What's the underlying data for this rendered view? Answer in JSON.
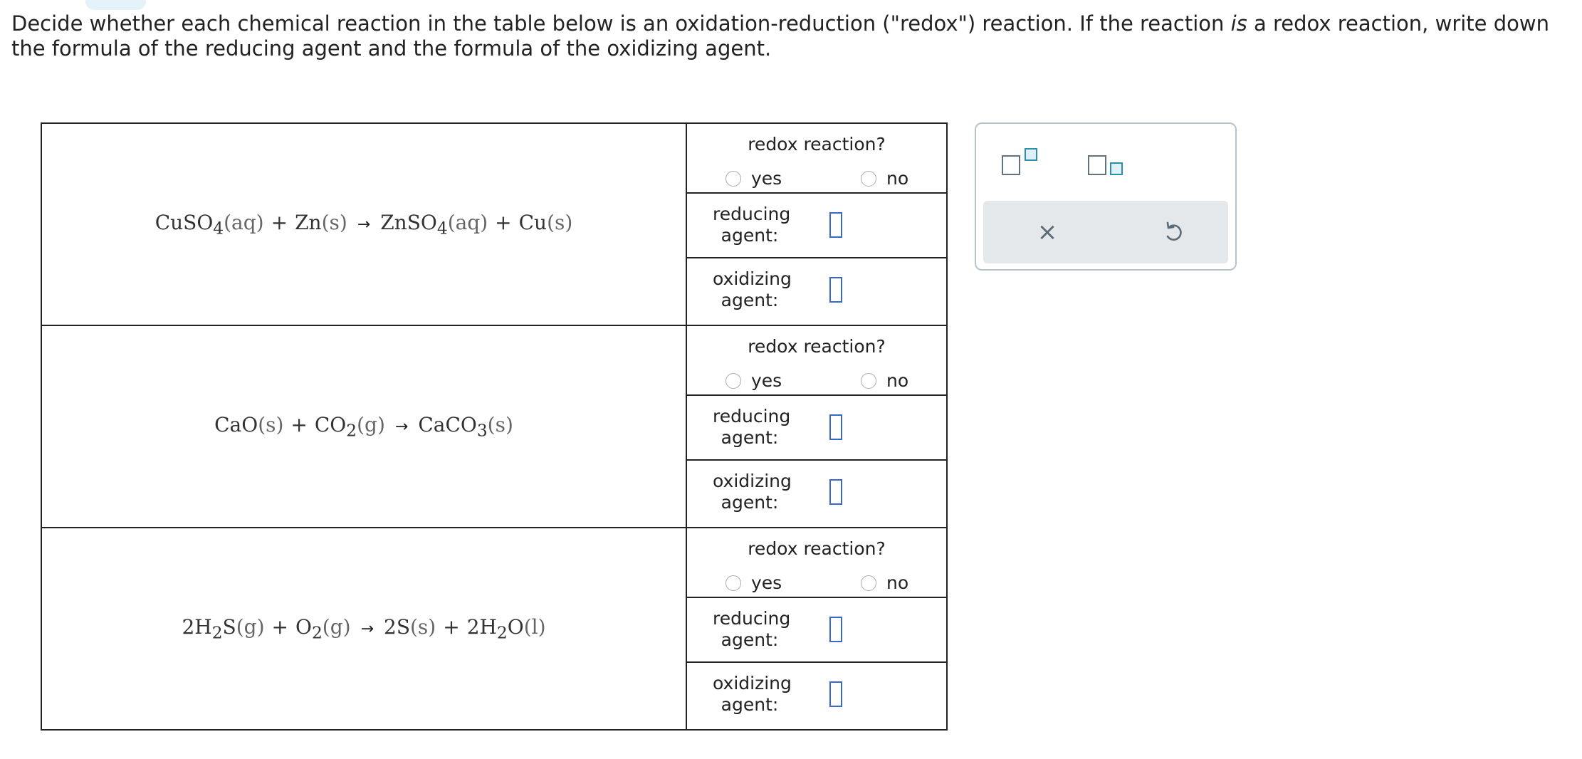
{
  "prompt": {
    "part1": "Decide whether each chemical reaction in the table below is an oxidation-reduction (\"redox\") reaction. If the reaction ",
    "em": "is",
    "part2": " a redox reaction, write down the formula of the reducing agent and the formula of the oxidizing agent."
  },
  "reactions": [
    {
      "question": "redox reaction?",
      "yes_label": "yes",
      "no_label": "no",
      "reducing_label": "reducing agent:",
      "oxidizing_label": "oxidizing agent:",
      "equation": {
        "r1": "CuSO",
        "r1_sub": "4",
        "r1_phase": "(aq)",
        "plus1": "+",
        "r2": "Zn",
        "r2_phase": "(s)",
        "arrow": "→",
        "p1": "ZnSO",
        "p1_sub": "4",
        "p1_phase": "(aq)",
        "plus2": "+",
        "p2": "Cu",
        "p2_phase": "(s)"
      }
    },
    {
      "question": "redox reaction?",
      "yes_label": "yes",
      "no_label": "no",
      "reducing_label": "reducing agent:",
      "oxidizing_label": "oxidizing agent:",
      "equation": {
        "r1": "CaO",
        "r1_phase": "(s)",
        "plus1": "+",
        "r2": "CO",
        "r2_sub": "2",
        "r2_phase": "(g)",
        "arrow": "→",
        "p1": "CaCO",
        "p1_sub": "3",
        "p1_phase": "(s)"
      }
    },
    {
      "question": "redox reaction?",
      "yes_label": "yes",
      "no_label": "no",
      "reducing_label": "reducing agent:",
      "oxidizing_label": "oxidizing agent:",
      "equation": {
        "r1": "2H",
        "r1_sub": "2",
        "r1_tail": "S",
        "r1_phase": "(g)",
        "plus1": "+",
        "r2": "O",
        "r2_sub": "2",
        "r2_phase": "(g)",
        "arrow": "→",
        "p1": "2S",
        "p1_phase": "(s)",
        "plus2": "+",
        "p2": "2H",
        "p2_sub": "2",
        "p2_tail": "O",
        "p2_phase": "(l)"
      }
    }
  ],
  "toolbox": {
    "superscript_icon": "superscript-template-icon",
    "subscript_icon": "subscript-template-icon",
    "clear_glyph": "×",
    "clear_icon": "close-icon",
    "undo_icon": "undo-icon"
  }
}
